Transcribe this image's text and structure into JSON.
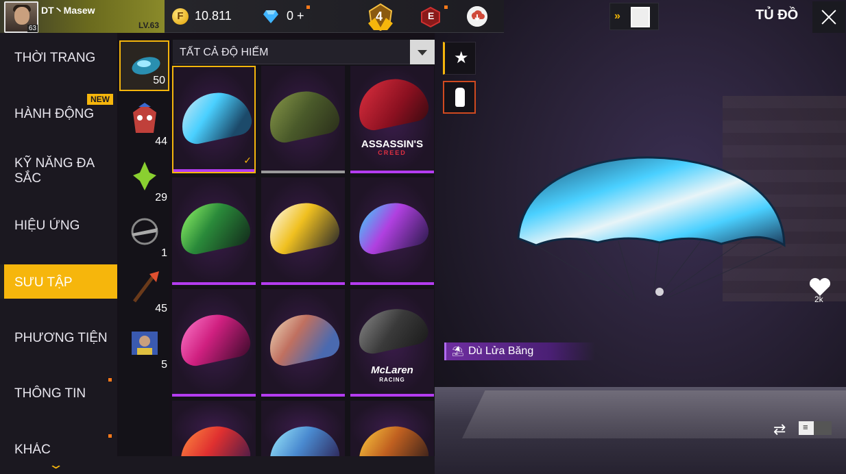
{
  "profile": {
    "name": "DT丶Masew",
    "level": "LV.63",
    "avatar_level": "63"
  },
  "currency": {
    "coins": "10.811",
    "diamonds": "0",
    "diamond_add": "+"
  },
  "rank": {
    "tier": "4"
  },
  "elite": {
    "letter": "E"
  },
  "header": {
    "title": "TỦ ĐỒ"
  },
  "nav": {
    "items": [
      {
        "label": "THỜI TRANG"
      },
      {
        "label": "HÀNH ĐỘNG"
      },
      {
        "label": "KỸ NĂNG ĐA SẮC"
      },
      {
        "label": "HIỆU ỨNG"
      },
      {
        "label": "SƯU TẬP"
      },
      {
        "label": "PHƯƠNG TIỆN"
      },
      {
        "label": "THÔNG TIN"
      },
      {
        "label": "KHÁC"
      }
    ],
    "new_badge": "NEW"
  },
  "subnav": {
    "counts": [
      "50",
      "44",
      "29",
      "1",
      "45",
      "5"
    ]
  },
  "filter": {
    "label": "TẤT CẢ ĐỘ HIẾM"
  },
  "grid": {
    "assassin_logo": "ASSASSIN'S",
    "assassin_sub": "CREED",
    "mclaren_logo": "McLaren",
    "mclaren_sub": "RACING"
  },
  "selected_item": {
    "name": "Dù Lửa Băng"
  },
  "likes": {
    "count": "2k"
  },
  "colors": {
    "accent": "#f6b60c",
    "rarity": "#b43cf0",
    "bg": "#141218"
  }
}
